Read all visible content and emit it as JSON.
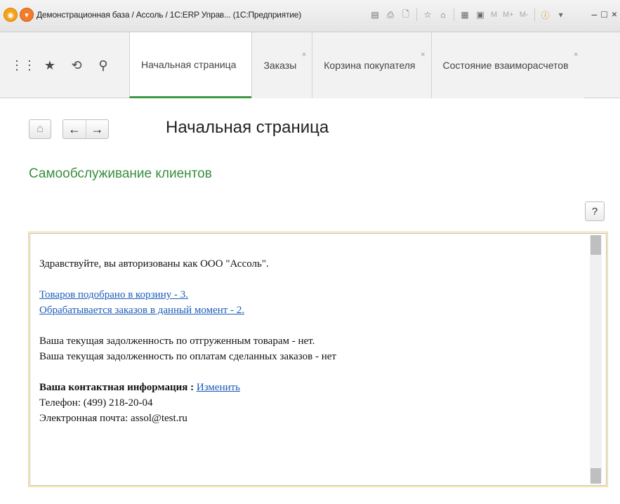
{
  "window": {
    "title": "Демонстрационная база / Ассоль / 1С:ERP Управ... (1С:Предприятие)",
    "toolbar_m_labels": [
      "M",
      "M+",
      "M-"
    ],
    "controls": [
      "‒",
      "□",
      "×"
    ]
  },
  "tabs": [
    {
      "label": "Начальная страница",
      "active": true,
      "closable": false
    },
    {
      "label": "Заказы",
      "active": false,
      "closable": true
    },
    {
      "label": "Корзина покупателя",
      "active": false,
      "closable": true
    },
    {
      "label": "Состояние взаиморасчетов",
      "active": false,
      "closable": true
    }
  ],
  "content": {
    "page_title": "Начальная страница",
    "group_title": "Самообслуживание клиентов",
    "help_label": "?",
    "greeting": "Здравствуйте, вы авторизованы как ООО \"Ассоль\".",
    "link_cart": "Товаров подобрано в корзину - 3.",
    "link_orders": " Обрабатывается заказов в данный момент - 2.",
    "debt_shipped": "Ваша текущая задолженность по отгруженным товарам - нет.",
    "debt_orders": "Ваша текущая задолженность по оплатам сделанных заказов - нет",
    "contact_label": "Ваша контактная информация : ",
    "contact_edit_link": "Изменить",
    "phone": "Телефон: (499) 218-20-04",
    "email": "Электронная почта: assol@test.ru"
  },
  "colors": {
    "accent_green": "#3c9a43",
    "link_blue": "#1a5bb8",
    "frame_yellow": "#f2cf6a"
  }
}
